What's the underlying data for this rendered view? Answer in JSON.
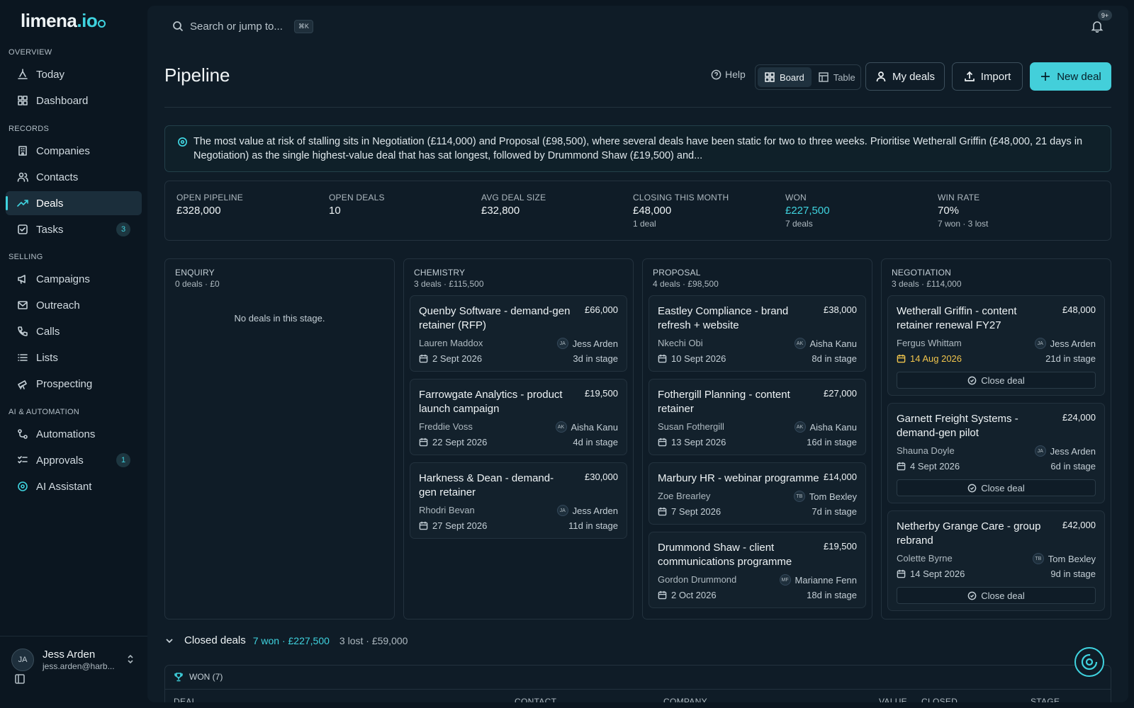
{
  "brand": {
    "name": "limena",
    "suffix": ".io"
  },
  "sidebar": {
    "sections": [
      "OVERVIEW",
      "RECORDS",
      "SELLING",
      "AI & AUTOMATION"
    ],
    "items": [
      {
        "label": "Today",
        "icon": "today-icon"
      },
      {
        "label": "Dashboard",
        "icon": "dashboard-icon"
      },
      {
        "label": "Companies",
        "icon": "building-icon"
      },
      {
        "label": "Contacts",
        "icon": "users-icon"
      },
      {
        "label": "Deals",
        "icon": "trend-icon",
        "active": true
      },
      {
        "label": "Tasks",
        "icon": "checkbox-icon",
        "count": "3"
      },
      {
        "label": "Campaigns",
        "icon": "megaphone-icon"
      },
      {
        "label": "Outreach",
        "icon": "mail-icon"
      },
      {
        "label": "Calls",
        "icon": "phone-icon"
      },
      {
        "label": "Lists",
        "icon": "list-icon"
      },
      {
        "label": "Prospecting",
        "icon": "telescope-icon"
      },
      {
        "label": "Automations",
        "icon": "workflow-icon"
      },
      {
        "label": "Approvals",
        "icon": "checklist-icon",
        "count": "1"
      },
      {
        "label": "AI Assistant",
        "icon": "ai-icon"
      }
    ],
    "user": {
      "initials": "JA",
      "name": "Jess Arden",
      "email": "jess.arden@harb..."
    }
  },
  "topbar": {
    "search_placeholder": "Search or jump to...",
    "shortcut": "⌘K",
    "notif_count": "9+"
  },
  "header": {
    "title": "Pipeline",
    "help": "Help",
    "view_board": "Board",
    "view_table": "Table",
    "my_deals": "My deals",
    "import": "Import",
    "new_deal": "New deal"
  },
  "insight": "The most value at risk of stalling sits in Negotiation (£114,000) and Proposal (£98,500), where several deals have been static for two to three weeks. Prioritise Wetherall Griffin (£48,000, 21 days in Negotiation) as the single highest-value deal that has sat longest, followed by Drummond Shaw (£19,500) and...",
  "stats": [
    {
      "label": "OPEN PIPELINE",
      "value": "£328,000",
      "sub": ""
    },
    {
      "label": "OPEN DEALS",
      "value": "10",
      "sub": ""
    },
    {
      "label": "AVG DEAL SIZE",
      "value": "£32,800",
      "sub": ""
    },
    {
      "label": "CLOSING THIS MONTH",
      "value": "£48,000",
      "sub": "1 deal"
    },
    {
      "label": "WON",
      "value": "£227,500",
      "sub": "7 deals",
      "accent": "#3fd3df"
    },
    {
      "label": "WIN RATE",
      "value": "70%",
      "sub": "7 won · 3 lost"
    }
  ],
  "columns": [
    {
      "name": "ENQUIRY",
      "meta": "0 deals · £0",
      "empty": "No deals in this stage.",
      "cards": []
    },
    {
      "name": "CHEMISTRY",
      "meta": "3 deals · £115,500",
      "cards": [
        {
          "title": "Quenby Software - demand-gen retainer (RFP)",
          "value": "£66,000",
          "contact": "Lauren Maddox",
          "owner_ini": "JA",
          "owner": "Jess Arden",
          "date": "2 Sept 2026",
          "age": "3d in stage"
        },
        {
          "title": "Farrowgate Analytics - product launch campaign",
          "value": "£19,500",
          "contact": "Freddie Voss",
          "owner_ini": "AK",
          "owner": "Aisha Kanu",
          "date": "22 Sept 2026",
          "age": "4d in stage"
        },
        {
          "title": "Harkness & Dean - demand-gen retainer",
          "value": "£30,000",
          "contact": "Rhodri Bevan",
          "owner_ini": "JA",
          "owner": "Jess Arden",
          "date": "27 Sept 2026",
          "age": "11d in stage"
        }
      ]
    },
    {
      "name": "PROPOSAL",
      "meta": "4 deals · £98,500",
      "cards": [
        {
          "title": "Eastley Compliance - brand refresh + website",
          "value": "£38,000",
          "contact": "Nkechi Obi",
          "owner_ini": "AK",
          "owner": "Aisha Kanu",
          "date": "10 Sept 2026",
          "age": "8d in stage"
        },
        {
          "title": "Fothergill Planning - content retainer",
          "value": "£27,000",
          "contact": "Susan Fothergill",
          "owner_ini": "AK",
          "owner": "Aisha Kanu",
          "date": "13 Sept 2026",
          "age": "16d in stage"
        },
        {
          "title": "Marbury HR - webinar programme",
          "value": "£14,000",
          "contact": "Zoe Brearley",
          "owner_ini": "TB",
          "owner": "Tom Bexley",
          "date": "7 Sept 2026",
          "age": "7d in stage"
        },
        {
          "title": "Drummond Shaw - client communications programme",
          "value": "£19,500",
          "contact": "Gordon Drummond",
          "owner_ini": "MF",
          "owner": "Marianne Fenn",
          "date": "2 Oct 2026",
          "age": "18d in stage"
        }
      ]
    },
    {
      "name": "NEGOTIATION",
      "meta": "3 deals · £114,000",
      "cards": [
        {
          "title": "Wetherall Griffin - content retainer renewal FY27",
          "value": "£48,000",
          "contact": "Fergus Whittam",
          "owner_ini": "JA",
          "owner": "Jess Arden",
          "date": "14 Aug 2026",
          "age": "21d in stage",
          "overdue": true,
          "action": "Close deal"
        },
        {
          "title": "Garnett Freight Systems - demand-gen pilot",
          "value": "£24,000",
          "contact": "Shauna Doyle",
          "owner_ini": "JA",
          "owner": "Jess Arden",
          "date": "4 Sept 2026",
          "age": "6d in stage",
          "action": "Close deal"
        },
        {
          "title": "Netherby Grange Care - group rebrand",
          "value": "£42,000",
          "contact": "Colette Byrne",
          "owner_ini": "TB",
          "owner": "Tom Bexley",
          "date": "14 Sept 2026",
          "age": "9d in stage",
          "action": "Close deal"
        }
      ]
    }
  ],
  "closed": {
    "label": "Closed deals",
    "won": "7 won · £227,500",
    "lost": "3 lost · £59,000",
    "won_header": "WON (7)",
    "columns": [
      "DEAL",
      "CONTACT",
      "COMPANY",
      "VALUE",
      "CLOSED",
      "STAGE"
    ]
  },
  "colors": {
    "accent": "#3fd3df",
    "warning": "#f0c44c",
    "background": "#0b1620"
  }
}
